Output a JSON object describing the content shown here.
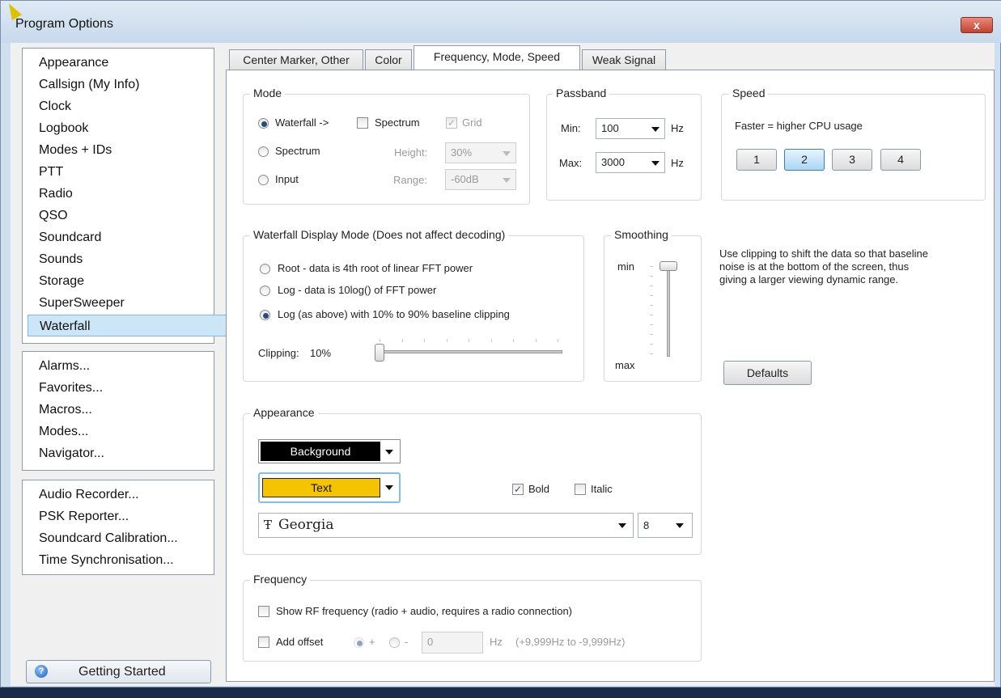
{
  "window": {
    "title": "Program Options",
    "close_label": "x"
  },
  "sidebar": {
    "categories": [
      {
        "label": "Appearance"
      },
      {
        "label": "Callsign (My Info)"
      },
      {
        "label": "Clock"
      },
      {
        "label": "Logbook"
      },
      {
        "label": "Modes + IDs"
      },
      {
        "label": "PTT"
      },
      {
        "label": "Radio"
      },
      {
        "label": "QSO"
      },
      {
        "label": "Soundcard"
      },
      {
        "label": "Sounds"
      },
      {
        "label": "Storage"
      },
      {
        "label": "SuperSweeper"
      },
      {
        "label": "Waterfall"
      }
    ],
    "selected": "Waterfall",
    "tools": [
      {
        "label": "Alarms..."
      },
      {
        "label": "Favorites..."
      },
      {
        "label": "Macros..."
      },
      {
        "label": "Modes..."
      },
      {
        "label": "Navigator..."
      }
    ],
    "utilities": [
      {
        "label": "Audio Recorder..."
      },
      {
        "label": "PSK Reporter..."
      },
      {
        "label": "Soundcard Calibration..."
      },
      {
        "label": "Time Synchronisation..."
      }
    ],
    "getting_started": "Getting Started"
  },
  "tabs": [
    {
      "label": "Center Marker, Other"
    },
    {
      "label": "Color"
    },
    {
      "label": "Frequency, Mode, Speed"
    },
    {
      "label": "Weak Signal"
    }
  ],
  "active_tab": "Frequency, Mode, Speed",
  "mode": {
    "title": "Mode",
    "waterfall": "Waterfall ->",
    "spectrum": "Spectrum",
    "input": "Input",
    "spectrum_check": "Spectrum",
    "grid_check": "Grid",
    "selected": "Waterfall ->",
    "spectrum_checked": false,
    "grid_checked": true,
    "height_label": "Height:",
    "height_value": "30%",
    "range_label": "Range:",
    "range_value": "-60dB"
  },
  "passband": {
    "title": "Passband",
    "min_label": "Min:",
    "min_value": "100",
    "max_label": "Max:",
    "max_value": "3000",
    "unit": "Hz"
  },
  "speed": {
    "title": "Speed",
    "note": "Faster = higher CPU usage",
    "buttons": [
      {
        "label": "1"
      },
      {
        "label": "2"
      },
      {
        "label": "3"
      },
      {
        "label": "4"
      }
    ],
    "selected": "2"
  },
  "waterfall_display": {
    "title": "Waterfall Display Mode (Does not affect decoding)",
    "options": [
      {
        "label": "Root - data is 4th root of linear FFT power"
      },
      {
        "label": "Log - data is 10log() of FFT power"
      },
      {
        "label": "Log (as above) with 10% to 90% baseline clipping"
      }
    ],
    "selected": "Log (as above) with 10% to 90% baseline clipping",
    "clipping_label": "Clipping:",
    "clipping_value": "10%",
    "clipping_level": 0.0
  },
  "smoothing": {
    "title": "Smoothing",
    "min": "min",
    "max": "max",
    "level": 0.0
  },
  "help_text": "Use clipping to shift the data so that baseline noise is at the bottom of the screen, thus giving a larger viewing dynamic range.",
  "defaults_button": "Defaults",
  "appearance": {
    "title": "Appearance",
    "background_label": "Background",
    "background_color": "#000000",
    "text_label": "Text",
    "text_color": "#f5c400",
    "bold_label": "Bold",
    "bold_checked": true,
    "italic_label": "Italic",
    "italic_checked": false,
    "font_icon": "Ŧ",
    "font_name": "Georgia",
    "font_size": "8"
  },
  "frequency": {
    "title": "Frequency",
    "show_rf": "Show RF frequency (radio + audio, requires a radio connection)",
    "show_rf_checked": false,
    "add_offset": "Add offset",
    "add_offset_checked": false,
    "plus": "+",
    "minus": "-",
    "offset_value": "0",
    "unit": "Hz",
    "range_hint": "(+9,999Hz to -9,999Hz)"
  }
}
